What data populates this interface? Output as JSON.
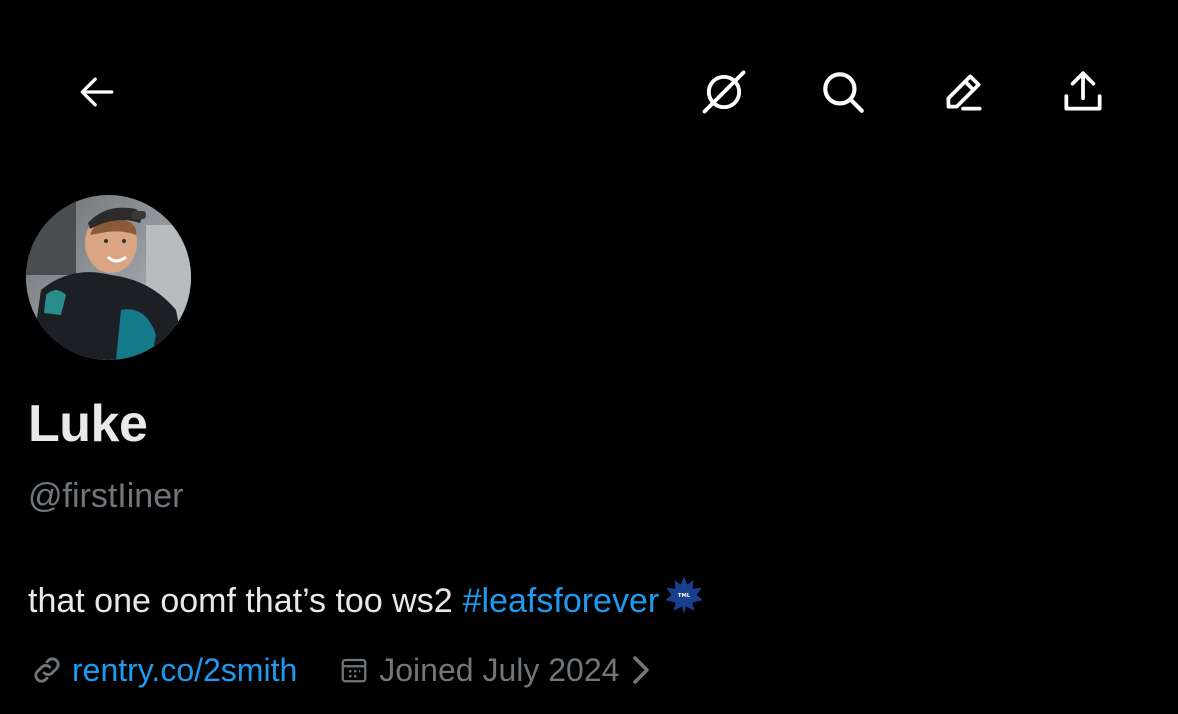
{
  "topbar": {
    "back_icon": "arrow-left-icon",
    "grok_icon": "grok-icon",
    "search_icon": "search-icon",
    "edit_icon": "edit-pencil-icon",
    "share_icon": "share-upload-icon"
  },
  "profile": {
    "display_name": "Luke",
    "handle": "@firstIiner",
    "bio_text": "that one oomf that’s too ws2",
    "bio_hashtag": "#leafsforever",
    "bio_emoji": "toronto-maple-leafs-emoji",
    "link_icon": "link-icon",
    "link_text": "rentry.co/2smith",
    "calendar_icon": "calendar-icon",
    "joined_text": "Joined July 2024",
    "chevron_icon": "chevron-right-icon"
  },
  "colors": {
    "background": "#000000",
    "primary_text": "#e7e9ea",
    "secondary_text": "#71767b",
    "accent": "#1d9bf0"
  }
}
